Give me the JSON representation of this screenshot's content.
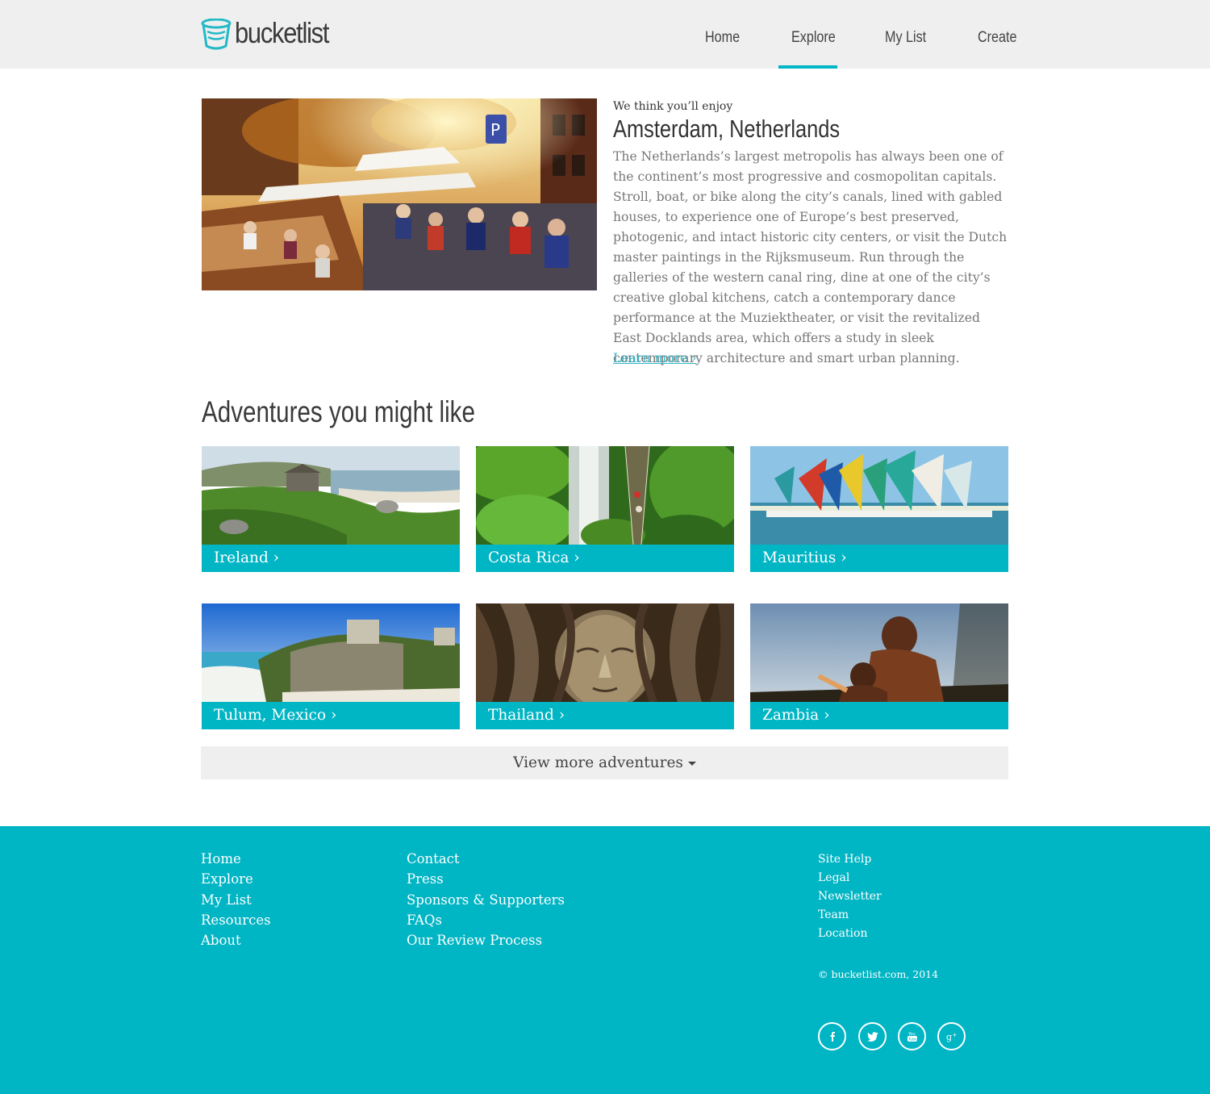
{
  "header": {
    "logo_text": "bucketlist",
    "nav": [
      "Home",
      "Explore",
      "My List",
      "Create"
    ],
    "active_nav": "Explore"
  },
  "featured": {
    "kicker": "We think you’ll enjoy",
    "title": "Amsterdam, Netherlands",
    "body": "The Netherlands’s largest metropolis has always been one of the continent’s most progressive and cosmopolitan capitals. Stroll, boat, or bike along the city’s canals, lined with gabled houses, to experience one of Europe’s best preserved, photogenic, and intact historic city centers, or visit the Dutch master paintings in the Rijksmuseum. Run through the galleries of the western canal ring, dine at one of the city’s creative global kitchens, catch a contemporary dance performance at the Muziektheater, or visit the revitalized East Docklands area, which offers a study in sleek contemporary architecture and smart urban planning.",
    "link": "Learn more ›"
  },
  "adventures": {
    "title": "Adventures you might like",
    "cards": [
      {
        "label": "Ireland ›"
      },
      {
        "label": "Costa Rica ›"
      },
      {
        "label": "Mauritius ›"
      },
      {
        "label": "Tulum, Mexico ›"
      },
      {
        "label": "Thailand ›"
      },
      {
        "label": "Zambia ›"
      }
    ],
    "more": "View more adventures"
  },
  "footer": {
    "col1": [
      "Home",
      "Explore",
      "My List",
      "Resources",
      "About"
    ],
    "col2": [
      "Contact",
      "Press",
      "Sponsors & Supporters",
      "FAQs",
      "Our Review Process"
    ],
    "col3": [
      "Site Help",
      "Legal",
      "Newsletter",
      "Team",
      "Location"
    ],
    "copyright": "© bucketlist.com, 2014",
    "social": [
      "facebook-icon",
      "twitter-icon",
      "youtube-icon",
      "google-plus-icon"
    ]
  },
  "colors": {
    "accent": "#00b5c4",
    "header_bg": "#efefef"
  }
}
